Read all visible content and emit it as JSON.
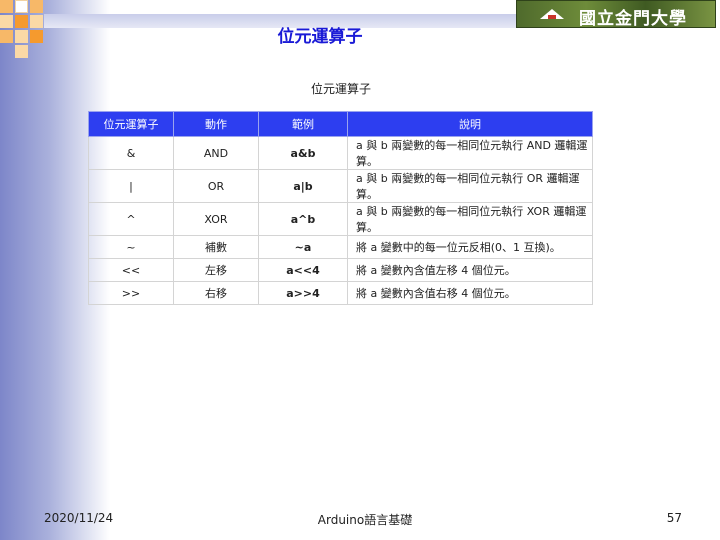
{
  "slide": {
    "title": "位元運算子",
    "logo_text": "國立金門大學",
    "accent_color": "#1a1ad6",
    "header_color": "#2d3ef0"
  },
  "table": {
    "caption": "位元運算子",
    "headers": [
      "位元運算子",
      "動作",
      "範例",
      "說明"
    ],
    "rows": [
      [
        "&",
        "AND",
        "a&b",
        "a 與 b 兩變數的每一相同位元執行 AND 邏輯運算。"
      ],
      [
        "|",
        "OR",
        "a|b",
        "a 與 b 兩變數的每一相同位元執行 OR 邏輯運算。"
      ],
      [
        "^",
        "XOR",
        "a^b",
        "a 與 b 兩變數的每一相同位元執行 XOR 邏輯運算。"
      ],
      [
        "~",
        "補數",
        "~a",
        "將 a 變數中的每一位元反相(0、1 互換)。"
      ],
      [
        "<<",
        "左移",
        "a<<4",
        "將 a 變數內含值左移 4 個位元。"
      ],
      [
        ">>",
        "右移",
        "a>>4",
        "將 a 變數內含值右移 4 個位元。"
      ]
    ]
  },
  "footer": {
    "date": "2020/11/24",
    "center": "Arduino語言基礎",
    "page": "57"
  }
}
